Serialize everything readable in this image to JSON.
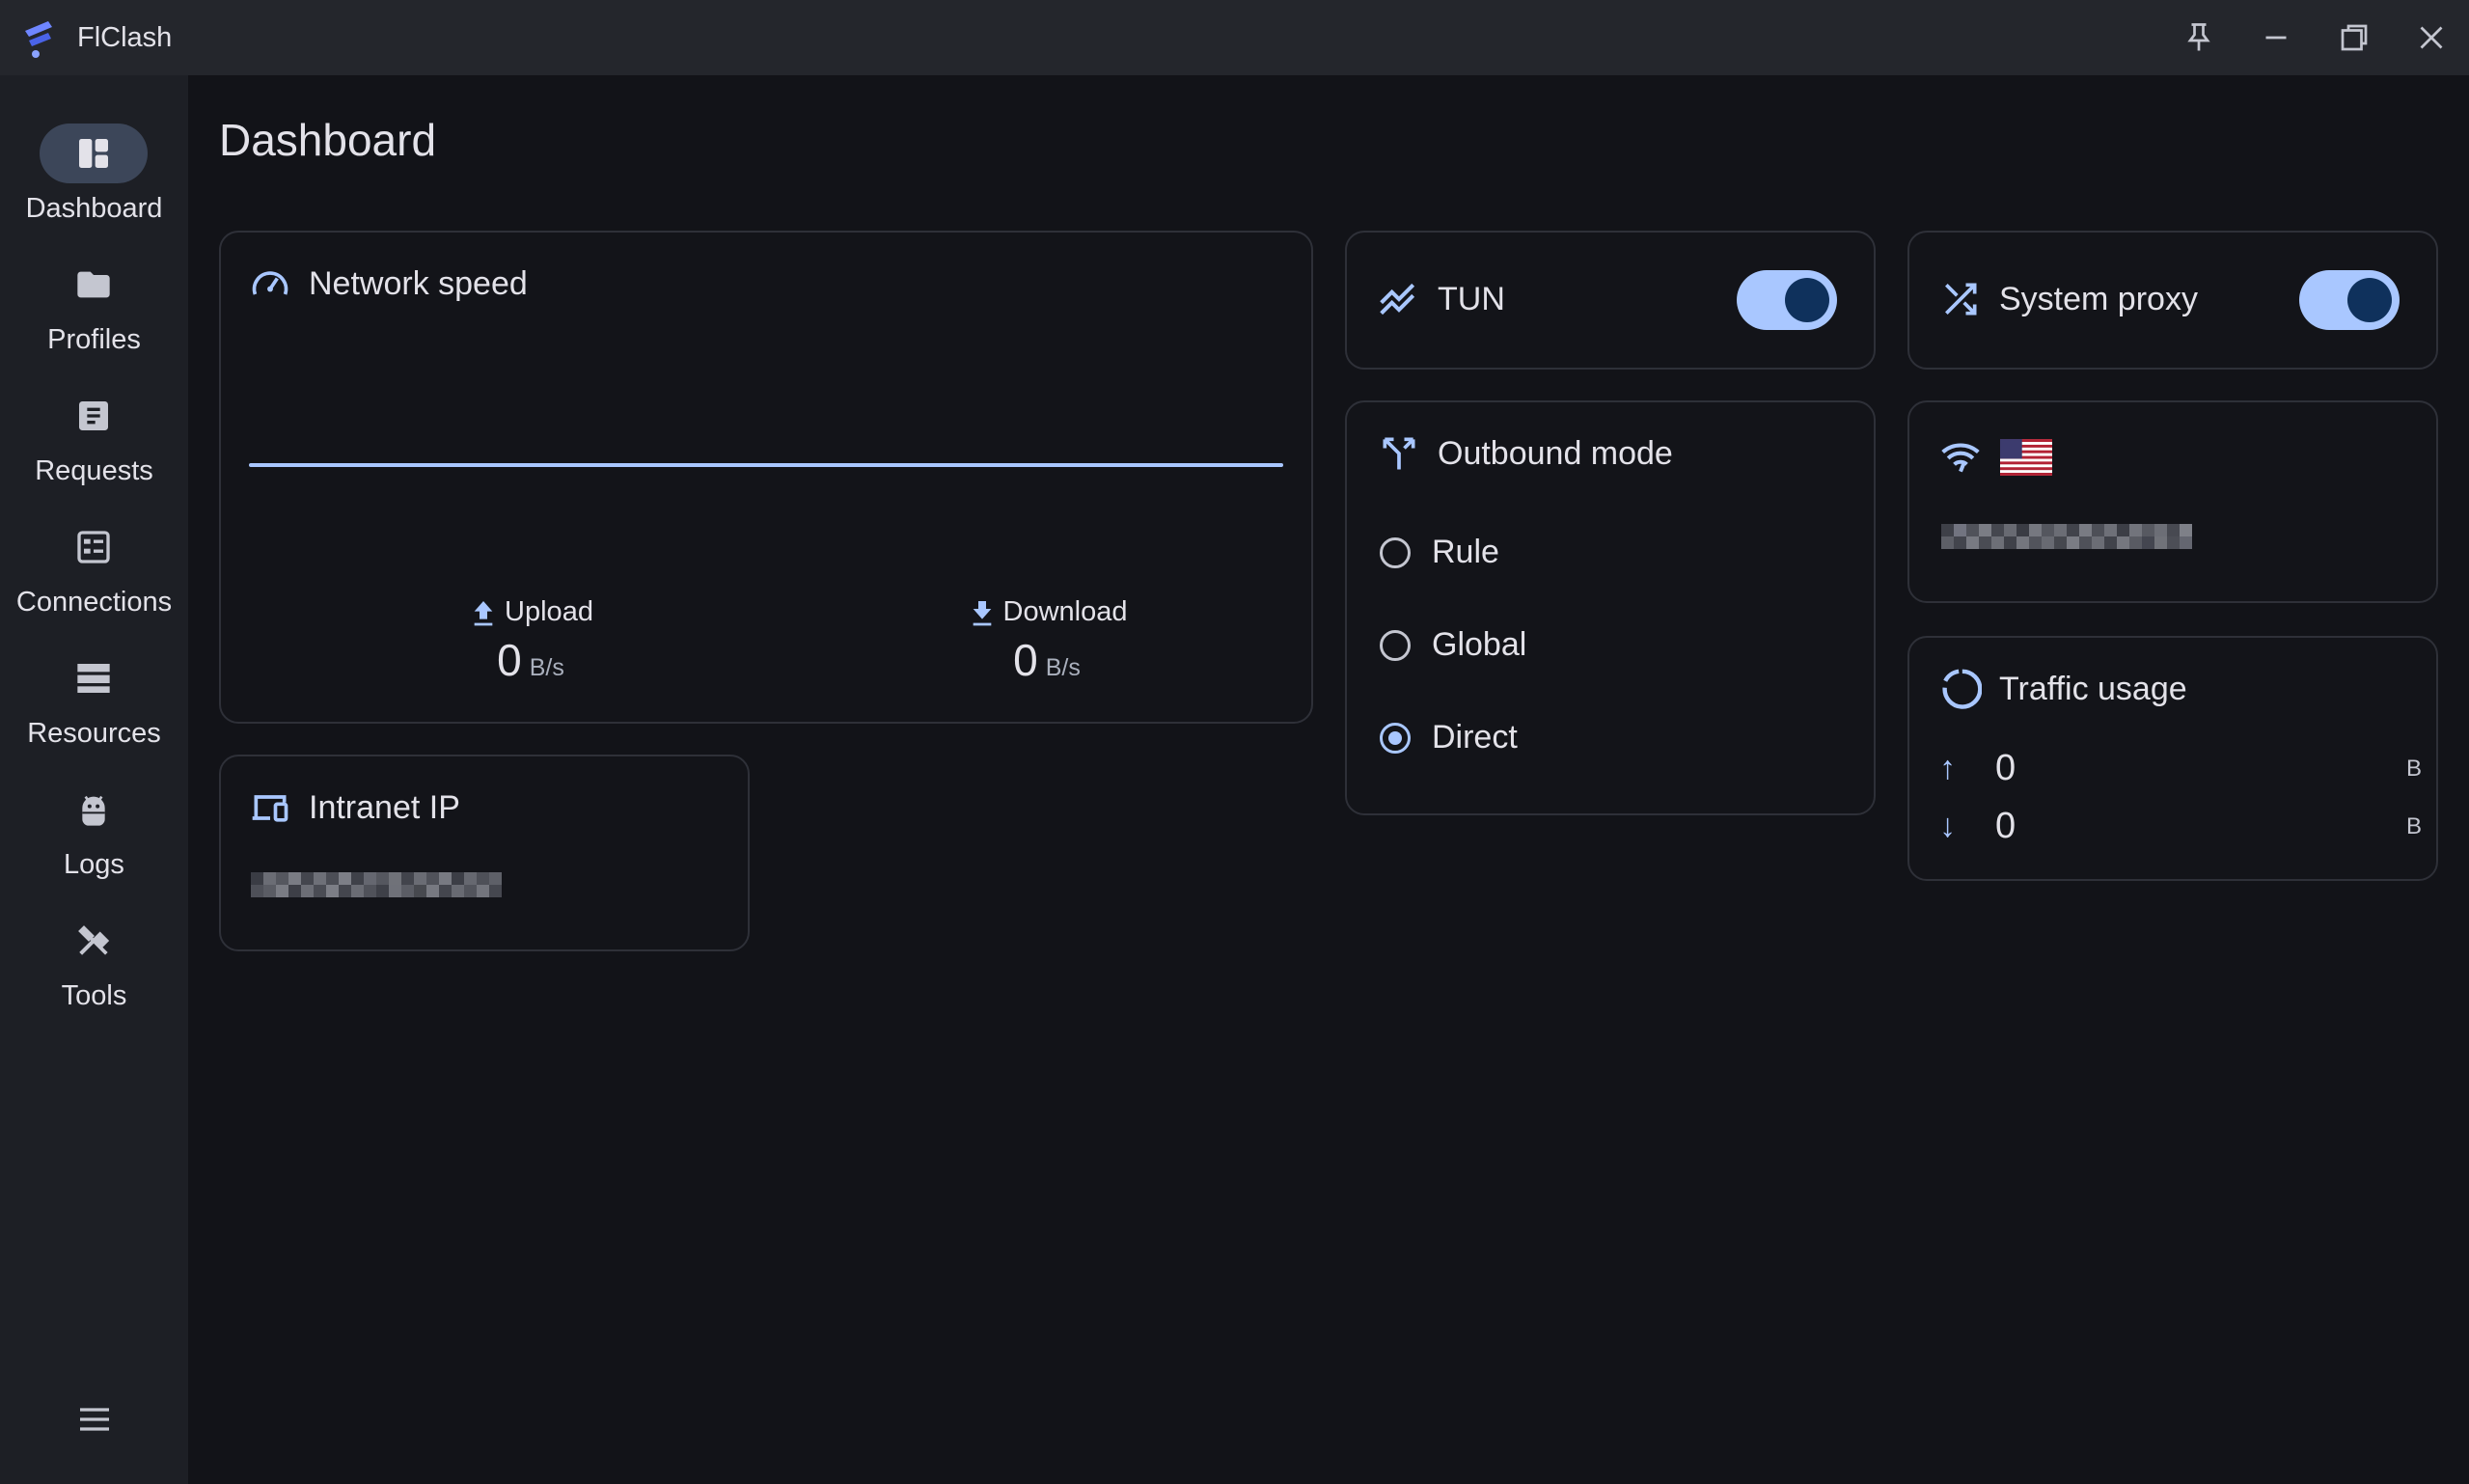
{
  "window": {
    "title": "FlClash",
    "controls": [
      "pin-icon",
      "minimize-icon",
      "maximize-icon",
      "close-icon"
    ]
  },
  "colors": {
    "accent": "#a9c7ff",
    "background": "#121318",
    "sidebar": "#1d1f25",
    "titlebar": "#24262c",
    "switch_knob": "#0f315c"
  },
  "sidebar": {
    "items": [
      {
        "label": "Dashboard",
        "icon": "dashboard-icon",
        "active": true
      },
      {
        "label": "Profiles",
        "icon": "folder-icon",
        "active": false
      },
      {
        "label": "Requests",
        "icon": "requests-icon",
        "active": false
      },
      {
        "label": "Connections",
        "icon": "connections-icon",
        "active": false
      },
      {
        "label": "Resources",
        "icon": "resources-icon",
        "active": false
      },
      {
        "label": "Logs",
        "icon": "android-icon",
        "active": false
      },
      {
        "label": "Tools",
        "icon": "tools-icon",
        "active": false
      }
    ],
    "menu_icon": "hamburger-menu-icon"
  },
  "page": {
    "title": "Dashboard"
  },
  "network_speed": {
    "title": "Network speed",
    "upload_label": "Upload",
    "upload_value": "0",
    "upload_unit": "B/s",
    "download_label": "Download",
    "download_value": "0",
    "download_unit": "B/s"
  },
  "tun": {
    "label": "TUN",
    "enabled": true
  },
  "system_proxy": {
    "label": "System proxy",
    "enabled": true
  },
  "outbound_mode": {
    "title": "Outbound mode",
    "options": [
      {
        "label": "Rule",
        "selected": false
      },
      {
        "label": "Global",
        "selected": false
      },
      {
        "label": "Direct",
        "selected": true
      }
    ]
  },
  "network_detection": {
    "flag_icon": "us-flag-icon",
    "ip_redacted": true
  },
  "intranet_ip": {
    "title": "Intranet IP",
    "ip_redacted": true
  },
  "traffic_usage": {
    "title": "Traffic usage",
    "upload_value": "0",
    "upload_unit": "B",
    "download_value": "0",
    "download_unit": "B"
  }
}
